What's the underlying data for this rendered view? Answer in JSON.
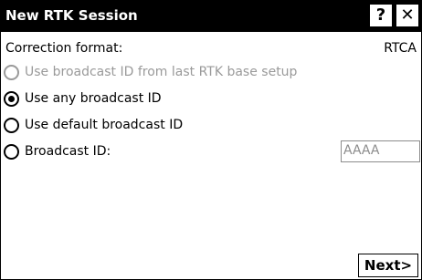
{
  "window": {
    "title": "New RTK Session",
    "help_label": "?",
    "close_label": "✕"
  },
  "correction": {
    "label": "Correction format:",
    "value": "RTCA"
  },
  "options": [
    {
      "label": "Use broadcast ID from last RTK base setup",
      "selected": false,
      "enabled": false
    },
    {
      "label": "Use any broadcast ID",
      "selected": true,
      "enabled": true
    },
    {
      "label": "Use default broadcast ID",
      "selected": false,
      "enabled": true
    },
    {
      "label": "Broadcast ID:",
      "selected": false,
      "enabled": true
    }
  ],
  "broadcast_id": {
    "value": "AAAA"
  },
  "footer": {
    "next_label": "Next>"
  }
}
